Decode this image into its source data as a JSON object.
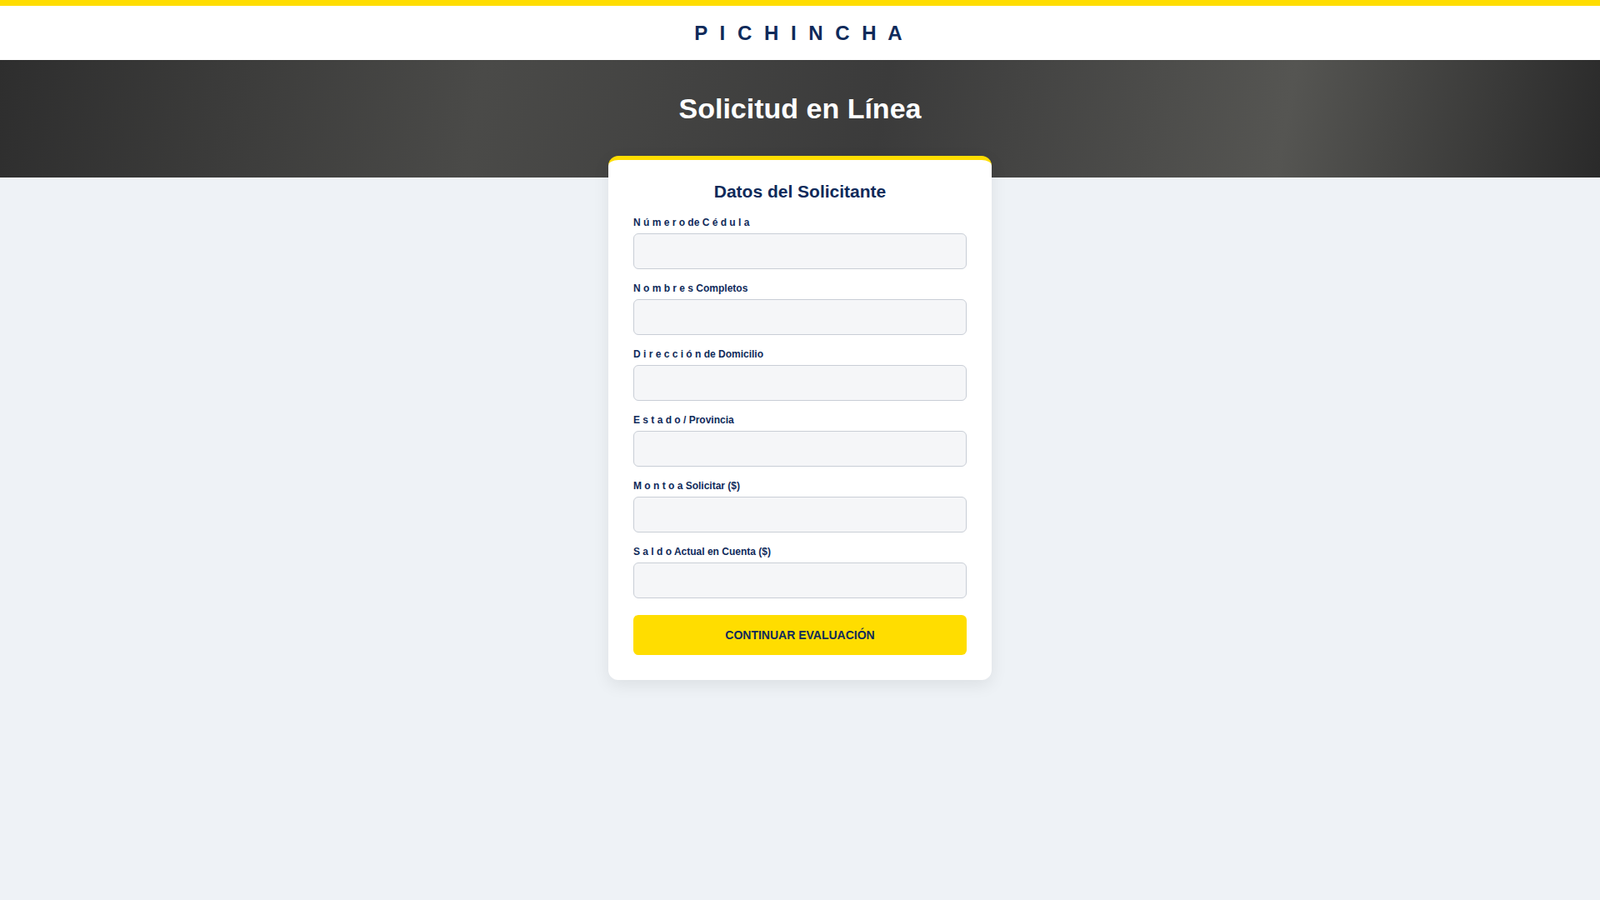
{
  "header": {
    "logo": "P I C H I N C H A"
  },
  "hero": {
    "title": "Solicitud en Línea"
  },
  "form": {
    "title": "Datos del Solicitante",
    "fields": [
      {
        "label": "N ú m e r o de C é d u l a",
        "value": ""
      },
      {
        "label": "N o m b r e s Completos",
        "value": ""
      },
      {
        "label": "D i r e c c i ó n de Domicilio",
        "value": ""
      },
      {
        "label": "E s t a d o / Provincia",
        "value": ""
      },
      {
        "label": "M o n t o a Solicitar ($)",
        "value": ""
      },
      {
        "label": "S a l d o Actual en Cuenta ($)",
        "value": ""
      }
    ],
    "button": "CONTINUAR EVALUACIÓN"
  }
}
